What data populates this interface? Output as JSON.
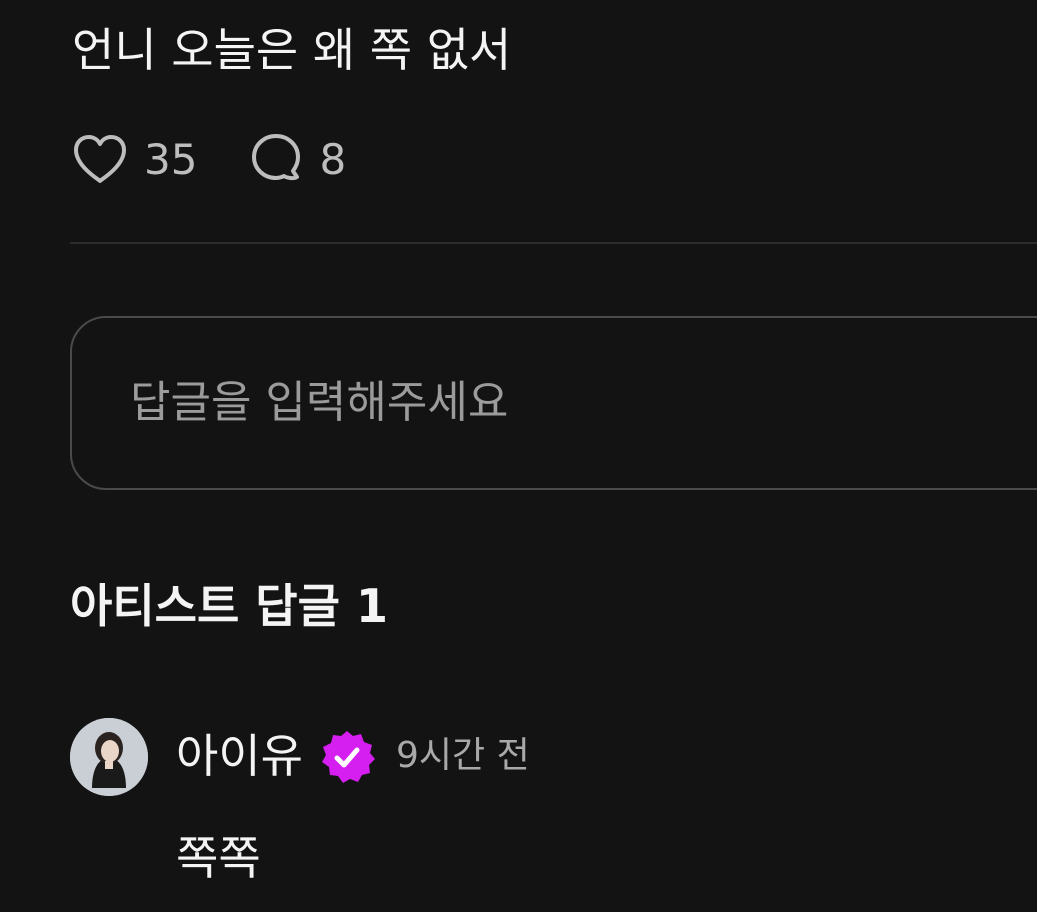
{
  "post": {
    "text": "언니 오늘은 왜 쪽 없서",
    "likes": "35",
    "comments": "8",
    "like_icon": "heart-icon",
    "comment_icon": "speech-bubble-icon"
  },
  "reply_box": {
    "placeholder": "답글을 입력해주세요",
    "value": ""
  },
  "artist_replies": {
    "title": "아티스트 답글 1",
    "items": [
      {
        "author": "아이유",
        "avatar_icon": "avatar",
        "badge_icon": "verified-badge-icon",
        "badge_color": "#d51ef0",
        "time": "9시간 전",
        "text": "쪽쪽"
      }
    ]
  }
}
